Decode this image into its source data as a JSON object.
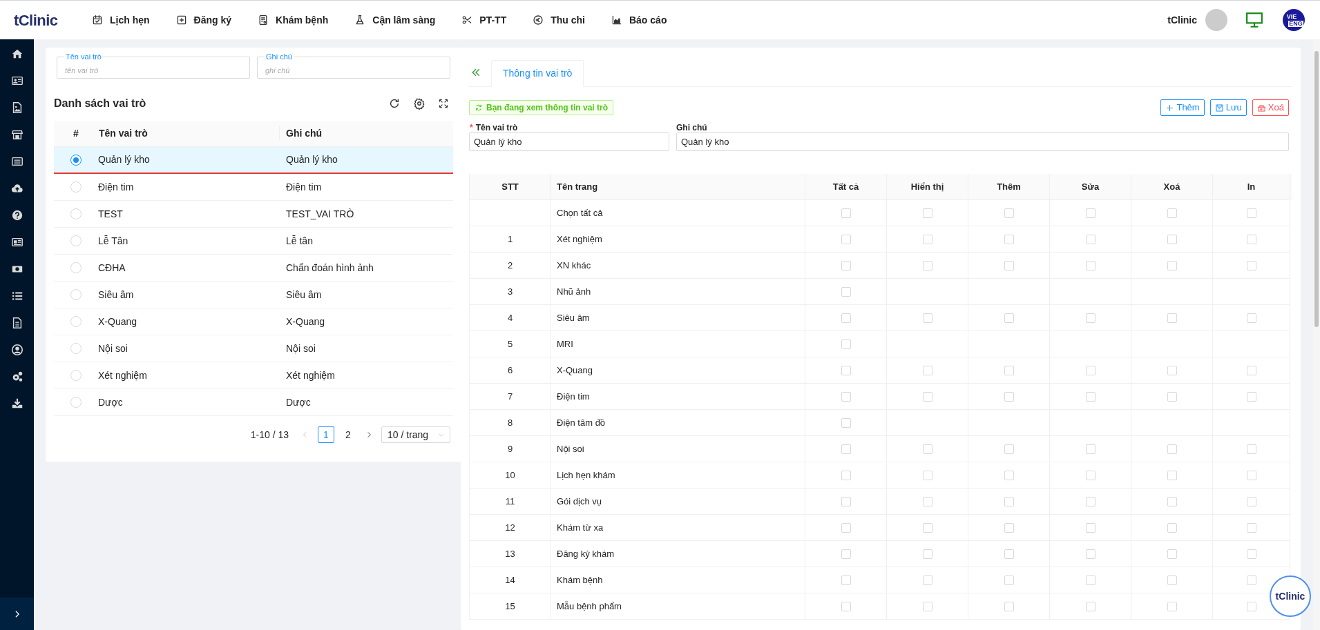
{
  "header": {
    "logo": "tClinic",
    "nav": [
      {
        "label": "Lịch hẹn"
      },
      {
        "label": "Đăng ký"
      },
      {
        "label": "Khám bệnh"
      },
      {
        "label": "Cận lâm sàng"
      },
      {
        "label": "PT-TT"
      },
      {
        "label": "Thu chi"
      },
      {
        "label": "Báo cáo"
      }
    ],
    "user": "tClinic",
    "languages": [
      {
        "label": "VIE",
        "selected": true
      },
      {
        "label": "ENG",
        "selected": false
      }
    ]
  },
  "filters": [
    {
      "label": "Tên vai trò",
      "placeholder": "tên vai trò"
    },
    {
      "label": "Ghi chú",
      "placeholder": "ghi chú"
    }
  ],
  "role_list": {
    "title": "Danh sách vai trò",
    "columns": [
      "#",
      "Tên vai trò",
      "Ghi chú"
    ],
    "rows": [
      {
        "name": "Quản lý kho",
        "note": "Quản lý kho",
        "selected": true
      },
      {
        "name": "Điện tim",
        "note": "Điện tim",
        "selected": false
      },
      {
        "name": "TEST",
        "note": "TEST_VAI TRÒ",
        "selected": false
      },
      {
        "name": "Lễ Tân",
        "note": "Lễ tân",
        "selected": false
      },
      {
        "name": "CĐHA",
        "note": "Chẩn đoán hình ảnh",
        "selected": false
      },
      {
        "name": "Siêu âm",
        "note": "Siêu âm",
        "selected": false
      },
      {
        "name": "X-Quang",
        "note": "X-Quang",
        "selected": false
      },
      {
        "name": "Nội soi",
        "note": "Nội soi",
        "selected": false
      },
      {
        "name": "Xét nghiệm",
        "note": "Xét nghiệm",
        "selected": false
      },
      {
        "name": "Dược",
        "note": "Dược",
        "selected": false
      }
    ],
    "pagination": {
      "range": "1-10 / 13",
      "prev_disabled": true,
      "pages": [
        {
          "label": "1",
          "selected": true
        },
        {
          "label": "2",
          "selected": false
        }
      ],
      "page_size": "10 / trang"
    }
  },
  "detail": {
    "tabs": [
      {
        "label": "Thông tin vai trò",
        "selected": true
      }
    ],
    "status": "Bạn đang xem thông tin vai trò",
    "buttons": [
      {
        "label": "Thêm",
        "kind": "add"
      },
      {
        "label": "Lưu",
        "kind": "save"
      },
      {
        "label": "Xoá",
        "kind": "delete"
      }
    ],
    "fields": [
      {
        "label": "Tên vai trò",
        "required_mark": "*",
        "value": "Quản lý kho"
      },
      {
        "label": "Ghi chú",
        "value": "Quản lý kho"
      }
    ],
    "table": {
      "columns": [
        "STT",
        "Tên trang",
        "Tất cả",
        "Hiển thị",
        "Thêm",
        "Sửa",
        "Xoá",
        "In"
      ],
      "rows": [
        {
          "stt": "",
          "page": "Chọn tất cả",
          "checks": [
            {
              "checked": false
            },
            {
              "checked": false
            },
            {
              "checked": false
            },
            {
              "checked": false
            },
            {
              "checked": false
            },
            {
              "checked": false
            }
          ]
        },
        {
          "stt": "1",
          "page": "Xét nghiệm",
          "checks": [
            {
              "checked": false
            },
            {
              "checked": false
            },
            {
              "checked": false
            },
            {
              "checked": false
            },
            {
              "checked": false
            },
            {
              "checked": false
            }
          ]
        },
        {
          "stt": "2",
          "page": "XN khác",
          "checks": [
            {
              "checked": false
            },
            {
              "checked": false
            },
            {
              "checked": false
            },
            {
              "checked": false
            },
            {
              "checked": false
            },
            {
              "checked": false
            }
          ]
        },
        {
          "stt": "3",
          "page": "Nhũ ảnh",
          "checks": [
            {
              "checked": false
            }
          ]
        },
        {
          "stt": "4",
          "page": "Siêu âm",
          "checks": [
            {
              "checked": false
            },
            {
              "checked": false
            },
            {
              "checked": false
            },
            {
              "checked": false
            },
            {
              "checked": false
            },
            {
              "checked": false
            }
          ]
        },
        {
          "stt": "5",
          "page": "MRI",
          "checks": [
            {
              "checked": false
            }
          ]
        },
        {
          "stt": "6",
          "page": "X-Quang",
          "checks": [
            {
              "checked": false
            },
            {
              "checked": false
            },
            {
              "checked": false
            },
            {
              "checked": false
            },
            {
              "checked": false
            },
            {
              "checked": false
            }
          ]
        },
        {
          "stt": "7",
          "page": "Điện tim",
          "checks": [
            {
              "checked": false
            },
            {
              "checked": false
            },
            {
              "checked": false
            },
            {
              "checked": false
            },
            {
              "checked": false
            },
            {
              "checked": false
            }
          ]
        },
        {
          "stt": "8",
          "page": "Điện tâm đồ",
          "checks": [
            {
              "checked": false
            }
          ]
        },
        {
          "stt": "9",
          "page": "Nội soi",
          "checks": [
            {
              "checked": false
            },
            {
              "checked": false
            },
            {
              "checked": false
            },
            {
              "checked": false
            },
            {
              "checked": false
            },
            {
              "checked": false
            }
          ]
        },
        {
          "stt": "10",
          "page": "Lịch hẹn khám",
          "checks": [
            {
              "checked": false
            },
            {
              "checked": false
            },
            {
              "checked": false
            },
            {
              "checked": false
            },
            {
              "checked": false
            },
            {
              "checked": false
            }
          ]
        },
        {
          "stt": "11",
          "page": "Gói dịch vụ",
          "checks": [
            {
              "checked": false
            },
            {
              "checked": false
            },
            {
              "checked": false
            },
            {
              "checked": false
            },
            {
              "checked": false
            },
            {
              "checked": false
            }
          ]
        },
        {
          "stt": "12",
          "page": "Khám từ xa",
          "checks": [
            {
              "checked": false
            },
            {
              "checked": false
            },
            {
              "checked": false
            },
            {
              "checked": false
            },
            {
              "checked": false
            },
            {
              "checked": false
            }
          ]
        },
        {
          "stt": "13",
          "page": "Đăng ký khám",
          "checks": [
            {
              "checked": false
            },
            {
              "checked": false
            },
            {
              "checked": false
            },
            {
              "checked": false
            },
            {
              "checked": false
            },
            {
              "checked": false
            }
          ]
        },
        {
          "stt": "14",
          "page": "Khám bệnh",
          "checks": [
            {
              "checked": false
            },
            {
              "checked": false
            },
            {
              "checked": false
            },
            {
              "checked": false
            },
            {
              "checked": false
            },
            {
              "checked": false
            }
          ]
        },
        {
          "stt": "15",
          "page": "Mẫu bệnh phẩm",
          "checks": [
            {
              "checked": false
            },
            {
              "checked": false
            },
            {
              "checked": false
            },
            {
              "checked": false
            },
            {
              "checked": false
            },
            {
              "checked": false
            }
          ]
        }
      ]
    }
  },
  "floating_logo": "tClinic"
}
